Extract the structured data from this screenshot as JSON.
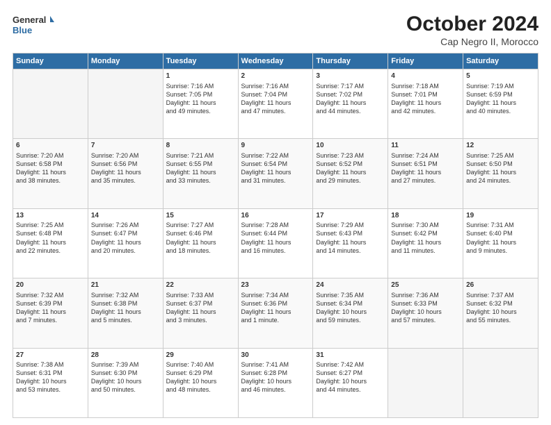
{
  "header": {
    "logo_line1": "General",
    "logo_line2": "Blue",
    "title": "October 2024",
    "subtitle": "Cap Negro II, Morocco"
  },
  "weekdays": [
    "Sunday",
    "Monday",
    "Tuesday",
    "Wednesday",
    "Thursday",
    "Friday",
    "Saturday"
  ],
  "weeks": [
    [
      {
        "day": "",
        "content": ""
      },
      {
        "day": "",
        "content": ""
      },
      {
        "day": "1",
        "content": "Sunrise: 7:16 AM\nSunset: 7:05 PM\nDaylight: 11 hours\nand 49 minutes."
      },
      {
        "day": "2",
        "content": "Sunrise: 7:16 AM\nSunset: 7:04 PM\nDaylight: 11 hours\nand 47 minutes."
      },
      {
        "day": "3",
        "content": "Sunrise: 7:17 AM\nSunset: 7:02 PM\nDaylight: 11 hours\nand 44 minutes."
      },
      {
        "day": "4",
        "content": "Sunrise: 7:18 AM\nSunset: 7:01 PM\nDaylight: 11 hours\nand 42 minutes."
      },
      {
        "day": "5",
        "content": "Sunrise: 7:19 AM\nSunset: 6:59 PM\nDaylight: 11 hours\nand 40 minutes."
      }
    ],
    [
      {
        "day": "6",
        "content": "Sunrise: 7:20 AM\nSunset: 6:58 PM\nDaylight: 11 hours\nand 38 minutes."
      },
      {
        "day": "7",
        "content": "Sunrise: 7:20 AM\nSunset: 6:56 PM\nDaylight: 11 hours\nand 35 minutes."
      },
      {
        "day": "8",
        "content": "Sunrise: 7:21 AM\nSunset: 6:55 PM\nDaylight: 11 hours\nand 33 minutes."
      },
      {
        "day": "9",
        "content": "Sunrise: 7:22 AM\nSunset: 6:54 PM\nDaylight: 11 hours\nand 31 minutes."
      },
      {
        "day": "10",
        "content": "Sunrise: 7:23 AM\nSunset: 6:52 PM\nDaylight: 11 hours\nand 29 minutes."
      },
      {
        "day": "11",
        "content": "Sunrise: 7:24 AM\nSunset: 6:51 PM\nDaylight: 11 hours\nand 27 minutes."
      },
      {
        "day": "12",
        "content": "Sunrise: 7:25 AM\nSunset: 6:50 PM\nDaylight: 11 hours\nand 24 minutes."
      }
    ],
    [
      {
        "day": "13",
        "content": "Sunrise: 7:25 AM\nSunset: 6:48 PM\nDaylight: 11 hours\nand 22 minutes."
      },
      {
        "day": "14",
        "content": "Sunrise: 7:26 AM\nSunset: 6:47 PM\nDaylight: 11 hours\nand 20 minutes."
      },
      {
        "day": "15",
        "content": "Sunrise: 7:27 AM\nSunset: 6:46 PM\nDaylight: 11 hours\nand 18 minutes."
      },
      {
        "day": "16",
        "content": "Sunrise: 7:28 AM\nSunset: 6:44 PM\nDaylight: 11 hours\nand 16 minutes."
      },
      {
        "day": "17",
        "content": "Sunrise: 7:29 AM\nSunset: 6:43 PM\nDaylight: 11 hours\nand 14 minutes."
      },
      {
        "day": "18",
        "content": "Sunrise: 7:30 AM\nSunset: 6:42 PM\nDaylight: 11 hours\nand 11 minutes."
      },
      {
        "day": "19",
        "content": "Sunrise: 7:31 AM\nSunset: 6:40 PM\nDaylight: 11 hours\nand 9 minutes."
      }
    ],
    [
      {
        "day": "20",
        "content": "Sunrise: 7:32 AM\nSunset: 6:39 PM\nDaylight: 11 hours\nand 7 minutes."
      },
      {
        "day": "21",
        "content": "Sunrise: 7:32 AM\nSunset: 6:38 PM\nDaylight: 11 hours\nand 5 minutes."
      },
      {
        "day": "22",
        "content": "Sunrise: 7:33 AM\nSunset: 6:37 PM\nDaylight: 11 hours\nand 3 minutes."
      },
      {
        "day": "23",
        "content": "Sunrise: 7:34 AM\nSunset: 6:36 PM\nDaylight: 11 hours\nand 1 minute."
      },
      {
        "day": "24",
        "content": "Sunrise: 7:35 AM\nSunset: 6:34 PM\nDaylight: 10 hours\nand 59 minutes."
      },
      {
        "day": "25",
        "content": "Sunrise: 7:36 AM\nSunset: 6:33 PM\nDaylight: 10 hours\nand 57 minutes."
      },
      {
        "day": "26",
        "content": "Sunrise: 7:37 AM\nSunset: 6:32 PM\nDaylight: 10 hours\nand 55 minutes."
      }
    ],
    [
      {
        "day": "27",
        "content": "Sunrise: 7:38 AM\nSunset: 6:31 PM\nDaylight: 10 hours\nand 53 minutes."
      },
      {
        "day": "28",
        "content": "Sunrise: 7:39 AM\nSunset: 6:30 PM\nDaylight: 10 hours\nand 50 minutes."
      },
      {
        "day": "29",
        "content": "Sunrise: 7:40 AM\nSunset: 6:29 PM\nDaylight: 10 hours\nand 48 minutes."
      },
      {
        "day": "30",
        "content": "Sunrise: 7:41 AM\nSunset: 6:28 PM\nDaylight: 10 hours\nand 46 minutes."
      },
      {
        "day": "31",
        "content": "Sunrise: 7:42 AM\nSunset: 6:27 PM\nDaylight: 10 hours\nand 44 minutes."
      },
      {
        "day": "",
        "content": ""
      },
      {
        "day": "",
        "content": ""
      }
    ]
  ]
}
